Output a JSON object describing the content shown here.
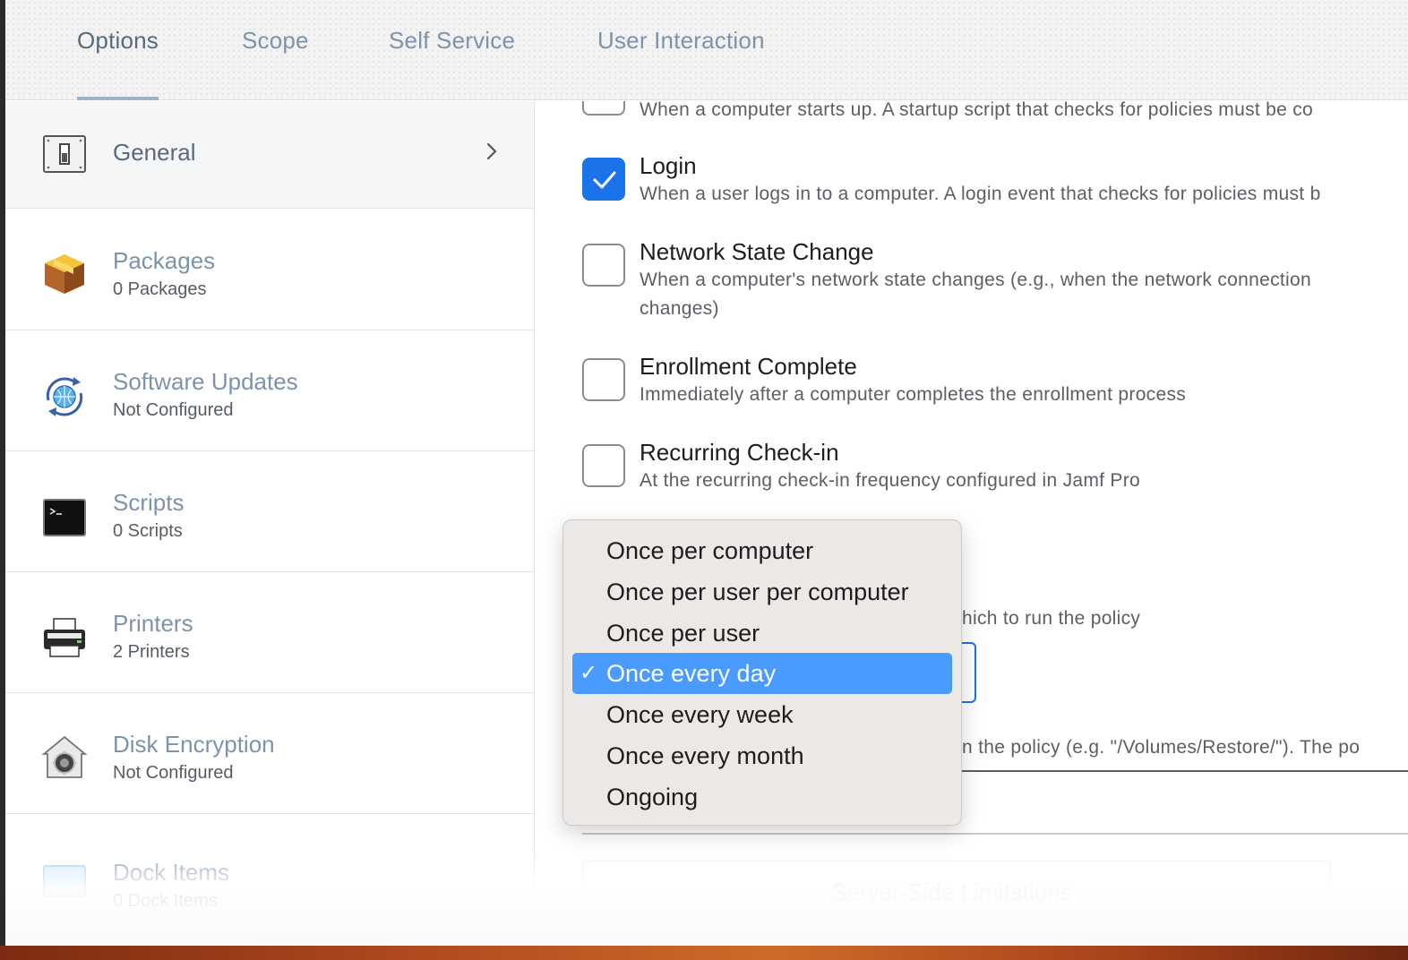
{
  "tabs": [
    {
      "label": "Options",
      "active": true
    },
    {
      "label": "Scope"
    },
    {
      "label": "Self Service"
    },
    {
      "label": "User Interaction"
    }
  ],
  "sidebar": {
    "items": [
      {
        "title": "General",
        "subtitle": "",
        "icon": "switch-icon"
      },
      {
        "title": "Packages",
        "subtitle": "0 Packages",
        "icon": "package-box-icon"
      },
      {
        "title": "Software Updates",
        "subtitle": "Not Configured",
        "icon": "software-update-globe-icon"
      },
      {
        "title": "Scripts",
        "subtitle": "0 Scripts",
        "icon": "terminal-icon"
      },
      {
        "title": "Printers",
        "subtitle": "2 Printers",
        "icon": "printer-icon"
      },
      {
        "title": "Disk Encryption",
        "subtitle": "Not Configured",
        "icon": "filevault-house-icon"
      },
      {
        "title": "Dock Items",
        "subtitle": "0 Dock Items",
        "icon": "dock-icon"
      }
    ]
  },
  "triggers": {
    "startup_desc": "When a computer starts up. A startup script that checks for policies must be co",
    "items": [
      {
        "title": "Login",
        "desc": "When a user logs in to a computer. A login event that checks for policies must b",
        "checked": true
      },
      {
        "title": "Network State Change",
        "desc": "When a computer's network state changes (e.g., when the network connection",
        "desc2": "changes)",
        "checked": false
      },
      {
        "title": "Enrollment Complete",
        "desc": "Immediately after a computer completes the enrollment process",
        "checked": false
      },
      {
        "title": "Recurring Check-in",
        "desc": "At the recurring check-in frequency configured in Jamf Pro",
        "checked": false
      }
    ]
  },
  "frequency": {
    "partial_label": "hich to run the policy",
    "options": [
      "Once per computer",
      "Once per user per computer",
      "Once per user",
      "Once every day",
      "Once every week",
      "Once every month",
      "Ongoing"
    ],
    "selected": "Once every day",
    "check_glyph": "✓"
  },
  "target_drive": {
    "partial_desc": "n the policy (e.g. \"/Volumes/Restore/\"). The po"
  },
  "server_side": {
    "title": "Server-Side Limitations"
  },
  "colors": {
    "accent": "#1a73e8",
    "menu_selection": "#4a9bff",
    "tab_inactive": "#7e93ab"
  }
}
